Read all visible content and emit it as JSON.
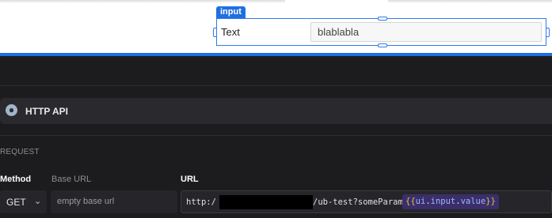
{
  "canvas": {
    "component_tag": "input",
    "component_label": "Text",
    "component_value": "blablabla"
  },
  "query": {
    "icon": "globe-icon",
    "title": "HTTP API"
  },
  "request": {
    "section_label": "REQUEST",
    "method_label": "Method",
    "method_value": "GET",
    "base_url_label": "Base URL",
    "base_url_placeholder": "empty base url",
    "url_label": "URL",
    "url_prefix": "http:/",
    "url_suffix": "/ub-test?someParam=",
    "template": {
      "open": "{{",
      "obj": "ui",
      "dot1": ".",
      "comp": "input",
      "dot2": ".",
      "prop": "value",
      "close": "}}"
    }
  },
  "colors": {
    "accent": "#1e6fe0",
    "panel_bg": "#1c1c1f",
    "template_bg": "#3b2e6a"
  }
}
